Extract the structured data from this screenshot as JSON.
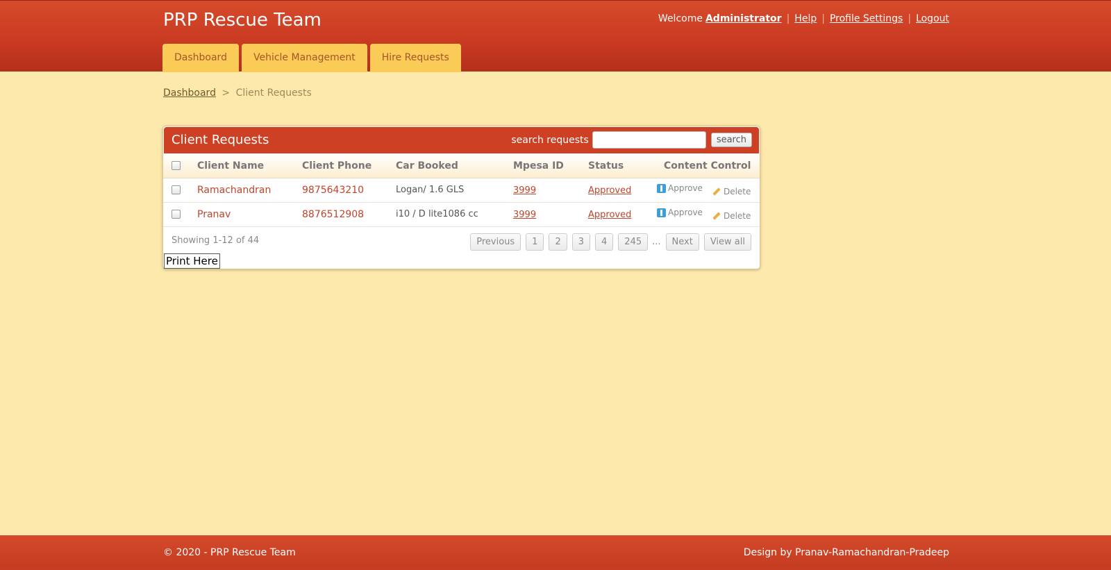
{
  "header": {
    "site_title": "PRP Rescue Team",
    "welcome": "Welcome",
    "user": "Administrator",
    "links": {
      "help": "Help",
      "profile": "Profile Settings",
      "logout": "Logout"
    },
    "separator": "|"
  },
  "tabs": [
    "Dashboard",
    "Vehicle Management",
    "Hire Requests"
  ],
  "breadcrumb": {
    "home": "Dashboard",
    "sep": ">",
    "current": "Client Requests"
  },
  "panel": {
    "title": "Client Requests",
    "search_label": "search requests",
    "search_value": "",
    "search_button": "search",
    "columns": [
      "Client Name",
      "Client Phone",
      "Car Booked",
      "Mpesa ID",
      "Status",
      "Content Control"
    ],
    "rows": [
      {
        "name": "Ramachandran",
        "phone": "9875643210",
        "car": "Logan/ 1.6 GLS",
        "mpesa": "3999",
        "status": "Approved",
        "approve": "Approve",
        "delete": "Delete"
      },
      {
        "name": "Pranav",
        "phone": "8876512908",
        "car": "i10 / D lite1086 cc",
        "mpesa": "3999",
        "status": "Approved",
        "approve": "Approve",
        "delete": "Delete"
      }
    ],
    "showing": "Showing 1-12 of 44",
    "pager": {
      "previous": "Previous",
      "pages": [
        "1",
        "2",
        "3",
        "4",
        "245"
      ],
      "ellipsis": "...",
      "next": "Next",
      "view_all": "View all"
    },
    "print_button": "Print Here"
  },
  "footer": {
    "copyright": "© 2020 - PRP Rescue Team",
    "credit": "Design by Pranav-Ramachandran-Pradeep"
  },
  "colors": {
    "header_bg": "#cd4024",
    "page_bg": "#fee9ad",
    "tab_bg": "#fbcb58",
    "link_red": "#c0432c"
  }
}
